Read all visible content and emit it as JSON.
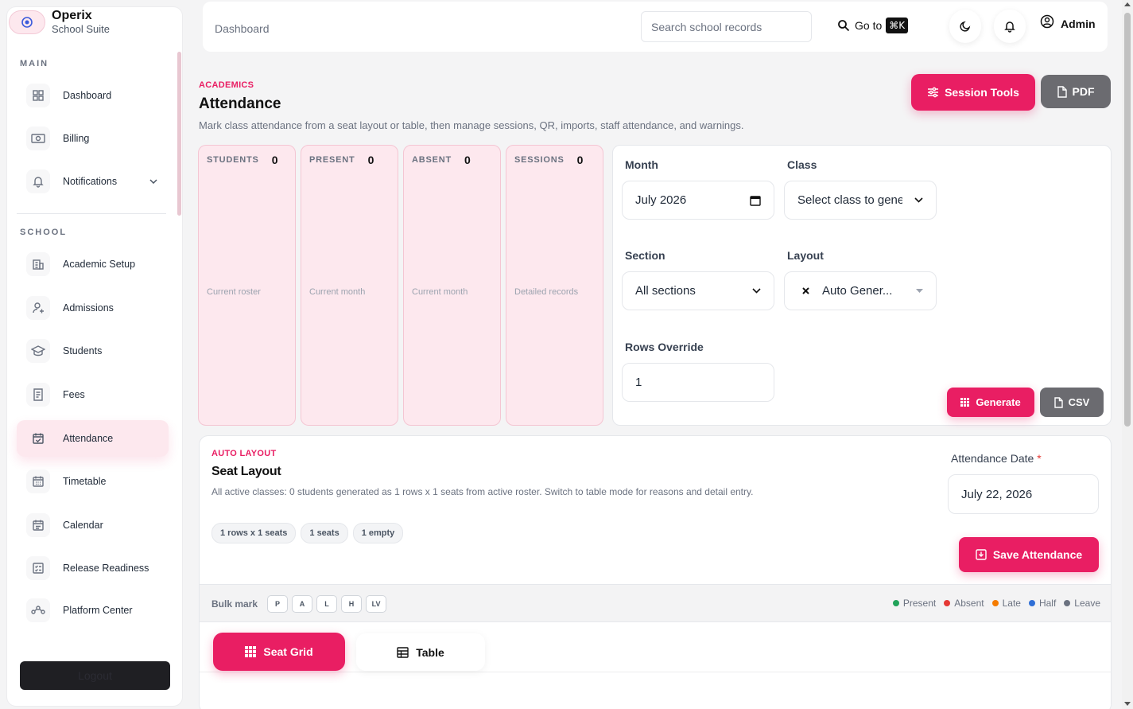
{
  "brand": {
    "name": "Operix",
    "subtitle": "School Suite"
  },
  "sidebar": {
    "sections": [
      {
        "label": "MAIN",
        "items": [
          {
            "label": "Dashboard",
            "icon": "grid-icon"
          },
          {
            "label": "Billing",
            "icon": "money-icon"
          },
          {
            "label": "Notifications",
            "icon": "bell-icon"
          }
        ]
      },
      {
        "label": "SCHOOL",
        "items": [
          {
            "label": "Academic Setup",
            "icon": "building-icon"
          },
          {
            "label": "Admissions",
            "icon": "user-plus-icon"
          },
          {
            "label": "Students",
            "icon": "graduation-cap-icon"
          },
          {
            "label": "Fees",
            "icon": "receipt-icon"
          },
          {
            "label": "Attendance",
            "icon": "calendar-check-icon"
          },
          {
            "label": "Timetable",
            "icon": "calendar-grid-icon"
          },
          {
            "label": "Calendar",
            "icon": "calendar-icon"
          },
          {
            "label": "Release Readiness",
            "icon": "checklist-icon"
          },
          {
            "label": "Platform Center",
            "icon": "network-icon"
          }
        ]
      }
    ],
    "logout_label": "Logout"
  },
  "topbar": {
    "breadcrumb": "Dashboard",
    "search_placeholder": "Search school records",
    "goto_label": "Go to",
    "goto_shortcut": "⌘K",
    "user_name": "Admin"
  },
  "page": {
    "eyebrow": "ACADEMICS",
    "title": "Attendance",
    "description": "Mark class attendance from a seat layout or table, then manage sessions, QR, imports, staff attendance, and warnings.",
    "session_tools_label": "Session Tools",
    "pdf_label": "PDF"
  },
  "stats": [
    {
      "label": "STUDENTS",
      "value": "0",
      "sub": "Current roster"
    },
    {
      "label": "PRESENT",
      "value": "0",
      "sub": "Current month"
    },
    {
      "label": "ABSENT",
      "value": "0",
      "sub": "Current month"
    },
    {
      "label": "SESSIONS",
      "value": "0",
      "sub": "Detailed records"
    }
  ],
  "form": {
    "month_label": "Month",
    "month_value": "July 2026",
    "class_label": "Class",
    "class_value": "Select class to genе",
    "section_label": "Section",
    "section_value": "All sections",
    "layout_label": "Layout",
    "layout_value": "Auto Gener...",
    "rows_label": "Rows Override",
    "rows_value": "1",
    "generate_label": "Generate",
    "csv_label": "CSV"
  },
  "seat_layout": {
    "eyebrow": "AUTO LAYOUT",
    "title": "Seat Layout",
    "description": "All active classes: 0 students generated as 1 rows x 1 seats from active roster. Switch to table mode for reasons and detail entry.",
    "chips": [
      "1 rows x 1 seats",
      "1 seats",
      "1 empty"
    ],
    "date_label": "Attendance Date",
    "date_value": "July 22, 2026",
    "save_label": "Save Attendance",
    "bulk_label": "Bulk mark",
    "bulk_buttons": [
      "P",
      "A",
      "L",
      "H",
      "LV"
    ],
    "legend": [
      {
        "label": "Present",
        "color": "#22a35a"
      },
      {
        "label": "Absent",
        "color": "#e53935"
      },
      {
        "label": "Late",
        "color": "#f57c00"
      },
      {
        "label": "Half",
        "color": "#2f6fd6"
      },
      {
        "label": "Leave",
        "color": "#6b7280"
      }
    ],
    "tabs": [
      "Seat Grid",
      "Table"
    ]
  },
  "colors": {
    "accent": "#e91e63",
    "accent_soft": "#fde8ee",
    "muted_button": "#6b6b70"
  }
}
